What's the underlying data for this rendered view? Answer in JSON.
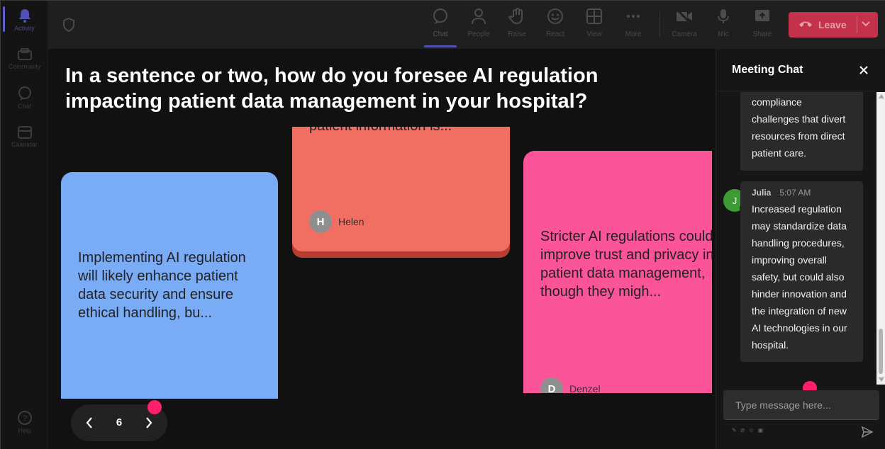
{
  "rail": {
    "items": [
      {
        "label": "Activity"
      },
      {
        "label": "Community"
      },
      {
        "label": "Chat"
      },
      {
        "label": "Calendar"
      },
      {
        "label": "Help"
      }
    ]
  },
  "toolbar": {
    "chat": "Chat",
    "people": "People",
    "raise": "Raise",
    "react": "React",
    "view": "View",
    "more": "More",
    "camera": "Camera",
    "mic": "Mic",
    "share": "Share",
    "leave": "Leave"
  },
  "stage": {
    "question": "In a sentence or two, how do you foresee AI regulation impacting patient data management in your hospital?",
    "cards": [
      {
        "text": "Implementing AI regulation will likely enhance patient data security and ensure ethical handling, bu...",
        "author": "",
        "initial": "",
        "color": "#7aacf6"
      },
      {
        "text": "patient information is...",
        "author": "Helen",
        "initial": "H",
        "color": "#f16f62"
      },
      {
        "text": "Stricter AI regulations could improve trust and privacy in patient data management, though they migh...",
        "author": "Denzel",
        "initial": "D",
        "color": "#fb5499"
      }
    ],
    "pager": {
      "current": "6"
    }
  },
  "chat": {
    "title": "Meeting Chat",
    "messages": [
      {
        "text": "compliance challenges that divert resources from direct patient care."
      },
      {
        "author": "Julia",
        "initial": "J",
        "time": "5:07 AM",
        "text": "Increased regulation may standardize data handling procedures, improving overall safety, but could also hinder innovation and the integration of new AI technologies in our hospital."
      }
    ],
    "compose_placeholder": "Type message here..."
  },
  "colors": {
    "leave": "#c4314b",
    "accent": "#5b5fc7",
    "cursor": "#ff1f6a"
  }
}
